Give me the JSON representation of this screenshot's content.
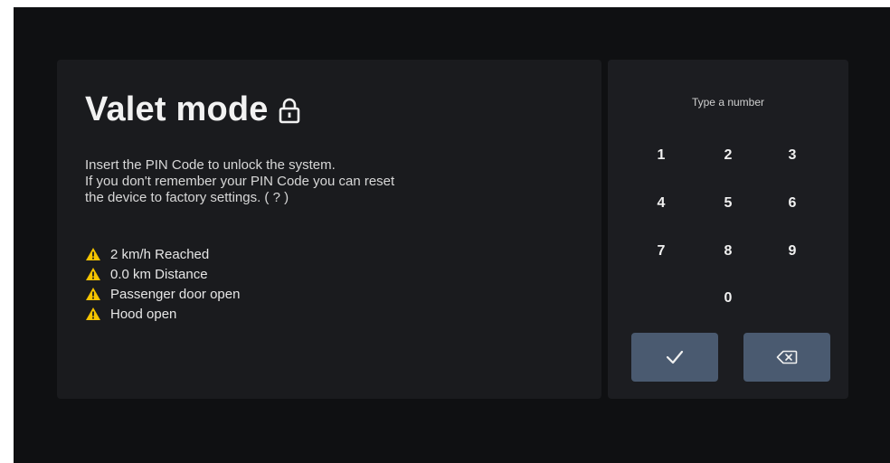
{
  "title": "Valet mode",
  "description": [
    "Insert the PIN Code to unlock the system.",
    "If you don't remember your PIN Code you can reset",
    "the device to factory settings. ( ? )"
  ],
  "warnings": [
    "2 km/h Reached",
    "0.0 km Distance",
    "Passenger door open",
    "Hood open"
  ],
  "keypad": {
    "prompt": "Type a number",
    "keys": [
      "1",
      "2",
      "3",
      "4",
      "5",
      "6",
      "7",
      "8",
      "9",
      "0"
    ],
    "confirm_icon": "checkmark-icon",
    "delete_icon": "backspace-icon"
  },
  "colors": {
    "warning": "#f5c400",
    "button": "#4a5a70"
  }
}
